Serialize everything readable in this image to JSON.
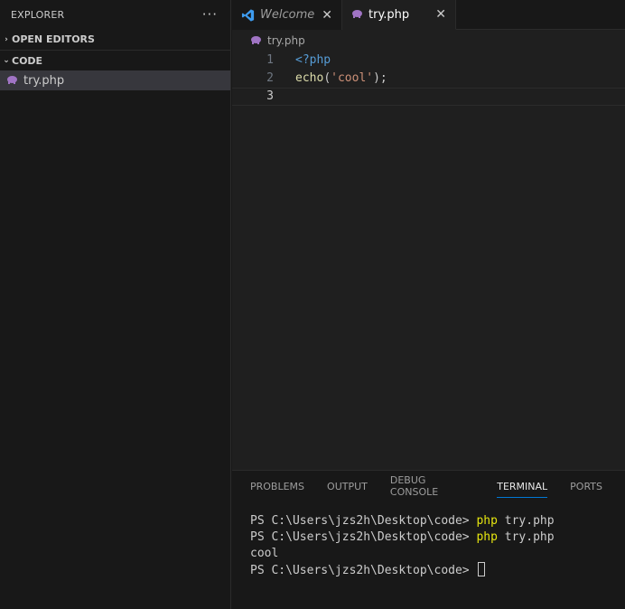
{
  "sidebar": {
    "title": "EXPLORER",
    "more_label": "···",
    "sections": [
      {
        "label": "OPEN EDITORS",
        "chevron": "›"
      },
      {
        "label": "CODE",
        "chevron": "⌄"
      }
    ],
    "files": [
      {
        "name": "try.php"
      }
    ]
  },
  "tabs": [
    {
      "label": "Welcome",
      "close": "✕"
    },
    {
      "label": "try.php",
      "close": "✕"
    }
  ],
  "breadcrumb": {
    "file": "try.php"
  },
  "editor": {
    "line_numbers": [
      "1",
      "2",
      "3"
    ],
    "lines": [
      [
        {
          "t": "<?php",
          "c": "kw"
        }
      ],
      [
        {
          "t": "echo",
          "c": "fn"
        },
        {
          "t": "(",
          "c": "punc"
        },
        {
          "t": "'cool'",
          "c": "str"
        },
        {
          "t": ");",
          "c": "punc"
        }
      ],
      []
    ]
  },
  "panel": {
    "tabs": [
      "PROBLEMS",
      "OUTPUT",
      "DEBUG CONSOLE",
      "TERMINAL",
      "PORTS"
    ],
    "active_tab": "TERMINAL",
    "terminal": {
      "lines": [
        {
          "prompt": "PS C:\\Users\\jzs2h\\Desktop\\code> ",
          "cmd": "php",
          "args": " try.php"
        },
        {
          "prompt": "PS C:\\Users\\jzs2h\\Desktop\\code> ",
          "cmd": "php",
          "args": " try.php"
        },
        {
          "output": "cool"
        },
        {
          "prompt": "PS C:\\Users\\jzs2h\\Desktop\\code> ",
          "cursor": true
        }
      ]
    }
  },
  "colors": {
    "accent": "#0078d4",
    "php_icon": "#a074c4",
    "keyword": "#569cd6",
    "function": "#dcdcaa",
    "string": "#ce9178",
    "terminal_command": "#e5e510"
  },
  "icons": {
    "php_file": "php-elephant-icon",
    "welcome_tab": "vscode-logo-icon",
    "close": "close-icon"
  }
}
